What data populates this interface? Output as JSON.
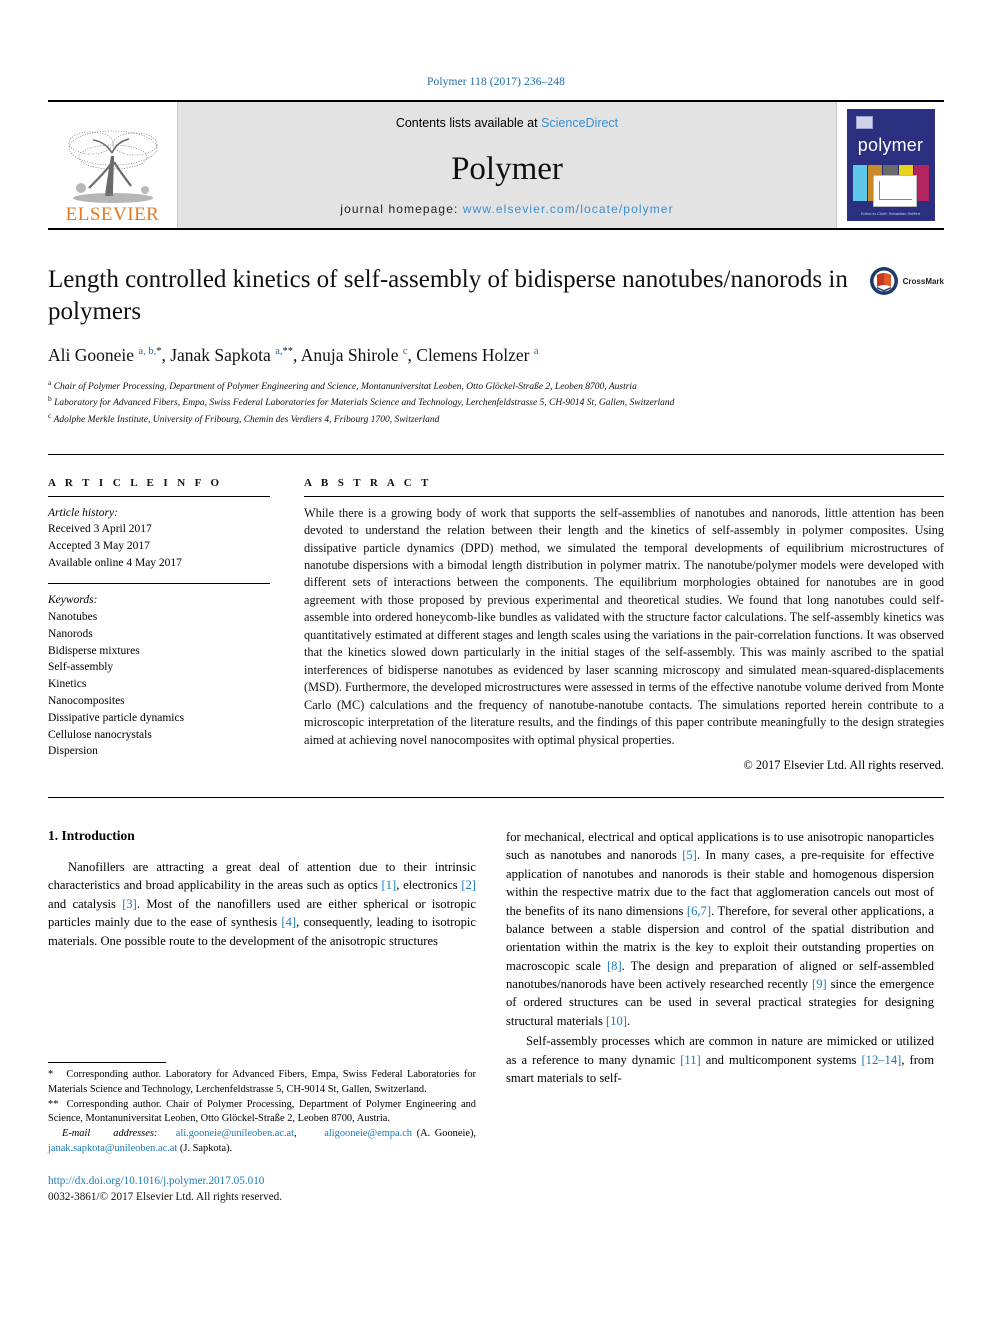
{
  "running_head": "Polymer 118 (2017) 236–248",
  "masthead": {
    "publisher_logo_text": "ELSEVIER",
    "contents_prefix": "Contents lists available at ",
    "contents_link": "ScienceDirect",
    "journal_name": "Polymer",
    "homepage_prefix": "journal homepage: ",
    "homepage_url": "www.elsevier.com/locate/polymer",
    "cover_title": "polymer",
    "cover_footer": "Editor-in-Chief: Sebastian Seiffert"
  },
  "article": {
    "title": "Length controlled kinetics of self-assembly of bidisperse nanotubes/nanorods in polymers",
    "crossmark_label": "CrossMark",
    "authors_html": "Ali Gooneie <sup>a, b,</sup><sup class=\"star\">*</sup>, Janak Sapkota <sup>a,</sup><sup class=\"star\">**</sup>, Anuja Shirole <sup>c</sup>, Clemens Holzer <sup>a</sup>",
    "affiliations": [
      {
        "marker": "a",
        "text": "Chair of Polymer Processing, Department of Polymer Engineering and Science, Montanuniversitat Leoben, Otto Glöckel-Straße 2, Leoben 8700, Austria"
      },
      {
        "marker": "b",
        "text": "Laboratory for Advanced Fibers, Empa, Swiss Federal Laboratories for Materials Science and Technology, Lerchenfeldstrasse 5, CH-9014 St, Gallen, Switzerland"
      },
      {
        "marker": "c",
        "text": "Adolphe Merkle Institute, University of Fribourg, Chemin des Verdiers 4, Fribourg 1700, Switzerland"
      }
    ]
  },
  "article_info": {
    "heading": "A R T I C L E   I N F O",
    "history_label": "Article history:",
    "history": [
      "Received 3 April 2017",
      "Accepted 3 May 2017",
      "Available online 4 May 2017"
    ],
    "keywords_label": "Keywords:",
    "keywords": [
      "Nanotubes",
      "Nanorods",
      "Bidisperse mixtures",
      "Self-assembly",
      "Kinetics",
      "Nanocomposites",
      "Dissipative particle dynamics",
      "Cellulose nanocrystals",
      "Dispersion"
    ]
  },
  "abstract": {
    "heading": "A B S T R A C T",
    "text": "While there is a growing body of work that supports the self-assemblies of nanotubes and nanorods, little attention has been devoted to understand the relation between their length and the kinetics of self-assembly in polymer composites. Using dissipative particle dynamics (DPD) method, we simulated the temporal developments of equilibrium microstructures of nanotube dispersions with a bimodal length distribution in polymer matrix. The nanotube/polymer models were developed with different sets of interactions between the components. The equilibrium morphologies obtained for nanotubes are in good agreement with those proposed by previous experimental and theoretical studies. We found that long nanotubes could self-assemble into ordered honeycomb-like bundles as validated with the structure factor calculations. The self-assembly kinetics was quantitatively estimated at different stages and length scales using the variations in the pair-correlation functions. It was observed that the kinetics slowed down particularly in the initial stages of the self-assembly. This was mainly ascribed to the spatial interferences of bidisperse nanotubes as evidenced by laser scanning microscopy and simulated mean-squared-displacements (MSD). Furthermore, the developed microstructures were assessed in terms of the effective nanotube volume derived from Monte Carlo (MC) calculations and the frequency of nanotube-nanotube contacts. The simulations reported herein contribute to a microscopic interpretation of the literature results, and the findings of this paper contribute meaningfully to the design strategies aimed at achieving novel nanocomposites with optimal physical properties.",
    "copyright": "© 2017 Elsevier Ltd. All rights reserved."
  },
  "introduction": {
    "heading": "1.  Introduction",
    "left_paragraph_html": "Nanofillers are attracting a great deal of attention due to their intrinsic characteristics and broad applicability in the areas such as optics <a class=\"cite\">[1]</a>, electronics <a class=\"cite\">[2]</a> and catalysis <a class=\"cite\">[3]</a>. Most of the nanofillers used are either spherical or isotropic particles mainly due to the ease of synthesis <a class=\"cite\">[4]</a>, consequently, leading to isotropic materials. One possible route to the development of the anisotropic structures",
    "right_paragraph_1_html": "for mechanical, electrical and optical applications is to use anisotropic nanoparticles such as nanotubes and nanorods <a class=\"cite\">[5]</a>. In many cases, a pre-requisite for effective application of nanotubes and nanorods is their stable and homogenous dispersion within the respective matrix due to the fact that agglomeration cancels out most of the benefits of its nano dimensions <a class=\"cite\">[6,7]</a>. Therefore, for several other applications, a balance between a stable dispersion and control of the spatial distribution and orientation within the matrix is the key to exploit their outstanding properties on macroscopic scale <a class=\"cite\">[8]</a>. The design and preparation of aligned or self-assembled nanotubes/nanorods have been actively researched recently <a class=\"cite\">[9]</a> since the emergence of ordered structures can be used in several practical strategies for designing structural materials <a class=\"cite\">[10]</a>.",
    "right_paragraph_2_html": "Self-assembly processes which are common in nature are mimicked or utilized as a reference to many dynamic <a class=\"cite\">[11]</a> and multicomponent systems <a class=\"cite\">[12–14]</a>, from smart materials to self-"
  },
  "footnotes": {
    "note_1_html": "<span class=\"ind\">*</span> Corresponding author. Laboratory for Advanced Fibers, Empa, Swiss Federal Laboratories for Materials Science and Technology, Lerchenfeldstrasse 5, CH-9014 St, Gallen, Switzerland.",
    "note_2_html": "<span class=\"ind\">**</span> Corresponding author. Chair of Polymer Processing, Department of Polymer Engineering and Science, Montanuniversitat Leoben, Otto Glöckel-Straße 2, Leoben 8700, Austria.",
    "emails_html": "<span class=\"ind\"></span><i>E-mail&nbsp;&nbsp;&nbsp;&nbsp;&nbsp;addresses:</i>&nbsp;&nbsp;&nbsp;&nbsp;<a>ali.gooneie@unileoben.ac.at</a>,&nbsp;&nbsp;&nbsp;&nbsp;&nbsp;&nbsp;<a>aligooneie@empa.ch</a> (A. Gooneie), <a>janak.sapkota@unileoben.ac.at</a> (J. Sapkota).",
    "doi": "http://dx.doi.org/10.1016/j.polymer.2017.05.010",
    "issn_html": "0032-3861/© 2017 Elsevier Ltd. All rights reserved."
  },
  "colors": {
    "link_blue": "#1a7bb9",
    "elsevier_orange": "#E87722",
    "cover_navy": "#2b2f7f",
    "masthead_gray": "#e3e3e3"
  }
}
